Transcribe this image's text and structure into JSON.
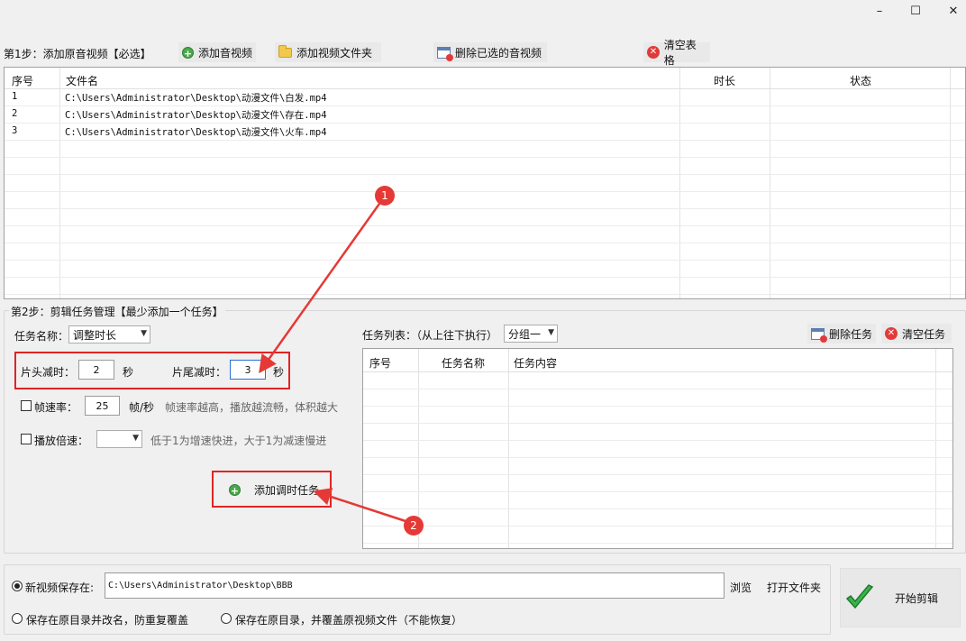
{
  "window_controls": {
    "minimize": "–",
    "maximize": "☐",
    "close": "✕"
  },
  "step1": {
    "label": "第1步：添加原音视频【必选】",
    "buttons": {
      "add_av": "添加音视频",
      "add_folder": "添加视频文件夹",
      "delete_selected": "删除已选的音视频",
      "clear_table": "清空表格"
    },
    "table": {
      "headers": {
        "index": "序号",
        "filename": "文件名",
        "duration": "时长",
        "status": "状态"
      },
      "rows": [
        {
          "index": "1",
          "filename": "C:\\Users\\Administrator\\Desktop\\动漫文件\\白发.mp4",
          "duration": "",
          "status": ""
        },
        {
          "index": "2",
          "filename": "C:\\Users\\Administrator\\Desktop\\动漫文件\\存在.mp4",
          "duration": "",
          "status": ""
        },
        {
          "index": "3",
          "filename": "C:\\Users\\Administrator\\Desktop\\动漫文件\\火车.mp4",
          "duration": "",
          "status": ""
        }
      ]
    }
  },
  "step2": {
    "label": "第2步：剪辑任务管理【最少添加一个任务】",
    "task_name_label": "任务名称：",
    "task_name_value": "调整时长",
    "head_cut_label": "片头减时：",
    "head_cut_value": "2",
    "tail_cut_label": "片尾减时：",
    "tail_cut_value": "3",
    "seconds_unit": "秒",
    "framerate_label": "帧速率：",
    "framerate_value": "25",
    "framerate_unit": "帧/秒",
    "framerate_hint": "帧速率越高，播放越流畅，体积越大",
    "speed_label": "播放倍速：",
    "speed_value": "",
    "speed_hint": "低于1为增速快进，大于1为减速慢进",
    "add_task_button": "添加调时任务",
    "task_list_label": "任务列表：（从上往下执行）",
    "group_value": "分组一",
    "delete_task": "删除任务",
    "clear_tasks": "清空任务",
    "task_table_headers": {
      "index": "序号",
      "name": "任务名称",
      "content": "任务内容"
    }
  },
  "output": {
    "new_save_label": "新视频保存在:",
    "path_value": "C:\\Users\\Administrator\\Desktop\\BBB",
    "browse": "浏览",
    "open_folder": "打开文件夹",
    "opt_rename": "保存在原目录并改名，防重复覆盖",
    "opt_overwrite": "保存在原目录，并覆盖原视频文件（不能恢复）",
    "start_button": "开始剪辑"
  },
  "annotations": {
    "badge1": "1",
    "badge2": "2"
  }
}
